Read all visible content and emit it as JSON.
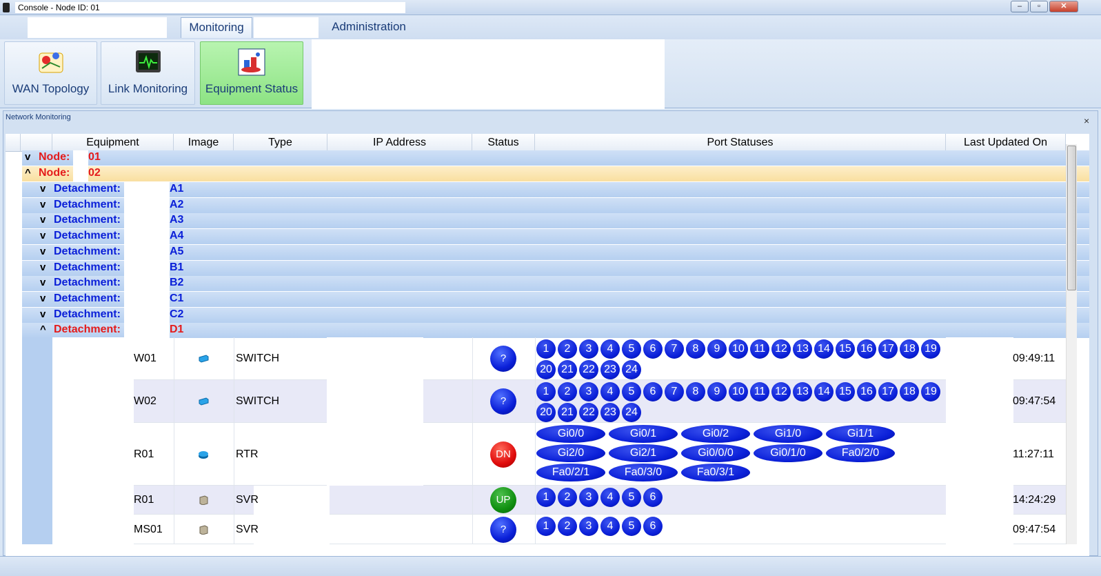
{
  "window": {
    "title": "Console - Node ID:      01",
    "minimize": "–",
    "maximize": "▫",
    "close": "✕"
  },
  "tabs": {
    "monitoring": "Monitoring",
    "administration": "Administration"
  },
  "ribbon": {
    "wan_topology": "WAN Topology",
    "link_monitoring": "Link Monitoring",
    "equipment_status": "Equipment Status"
  },
  "panel": {
    "title": "Network Monitoring",
    "close": "×"
  },
  "grid": {
    "columns": [
      "Equipment",
      "Image",
      "Type",
      "IP Address",
      "Status",
      "Port Statuses",
      "Last Updated On"
    ],
    "nodes": [
      {
        "label": "Node:",
        "suffix": "01",
        "chevron": "v"
      },
      {
        "label": "Node:",
        "suffix": "02",
        "chevron": "^"
      }
    ],
    "detachments": [
      {
        "label": "Detachment:",
        "suffix": "A1",
        "chevron": "v"
      },
      {
        "label": "Detachment:",
        "suffix": "A2",
        "chevron": "v"
      },
      {
        "label": "Detachment:",
        "suffix": "A3",
        "chevron": "v"
      },
      {
        "label": "Detachment:",
        "suffix": "A4",
        "chevron": "v"
      },
      {
        "label": "Detachment:",
        "suffix": "A5",
        "chevron": "v"
      },
      {
        "label": "Detachment:",
        "suffix": "B1",
        "chevron": "v"
      },
      {
        "label": "Detachment:",
        "suffix": "B2",
        "chevron": "v"
      },
      {
        "label": "Detachment:",
        "suffix": "C1",
        "chevron": "v"
      },
      {
        "label": "Detachment:",
        "suffix": "C2",
        "chevron": "v"
      },
      {
        "label": "Detachment:",
        "suffix": "D1",
        "chevron": "^"
      }
    ],
    "equipment": [
      {
        "name": "W01",
        "type": "SWITCH",
        "status": "?",
        "status_kind": "unknown",
        "ports": [
          "1",
          "2",
          "3",
          "4",
          "5",
          "6",
          "7",
          "8",
          "9",
          "10",
          "11",
          "12",
          "13",
          "14",
          "15",
          "16",
          "17",
          "18",
          "19",
          "20",
          "21",
          "22",
          "23",
          "24"
        ],
        "port_style": "num",
        "updated": "09:49:11",
        "icon": "switch-icon"
      },
      {
        "name": "W02",
        "type": "SWITCH",
        "status": "?",
        "status_kind": "unknown",
        "ports": [
          "1",
          "2",
          "3",
          "4",
          "5",
          "6",
          "7",
          "8",
          "9",
          "10",
          "11",
          "12",
          "13",
          "14",
          "15",
          "16",
          "17",
          "18",
          "19",
          "20",
          "21",
          "22",
          "23",
          "24"
        ],
        "port_style": "num",
        "updated": "09:47:54",
        "icon": "switch-icon"
      },
      {
        "name": "R01",
        "type": "RTR",
        "status": "DN",
        "status_kind": "down",
        "ports": [
          "Gi0/0",
          "Gi0/1",
          "Gi0/2",
          "Gi1/0",
          "Gi1/1",
          "Gi2/0",
          "Gi2/1",
          "Gi0/0/0",
          "Gi0/1/0",
          "Fa0/2/0",
          "Fa0/2/1",
          "Fa0/3/0",
          "Fa0/3/1"
        ],
        "port_style": "gi",
        "updated": "11:27:11",
        "icon": "router-icon"
      },
      {
        "name": "R01",
        "type": "SVR",
        "status": "UP",
        "status_kind": "up",
        "ports": [
          "1",
          "2",
          "3",
          "4",
          "5",
          "6"
        ],
        "port_style": "num",
        "updated": "14:24:29",
        "icon": "server-icon"
      },
      {
        "name": "MS01",
        "type": "SVR",
        "status": "?",
        "status_kind": "unknown",
        "ports": [
          "1",
          "2",
          "3",
          "4",
          "5",
          "6"
        ],
        "port_style": "num",
        "updated": "09:47:54",
        "icon": "server-icon"
      }
    ]
  }
}
